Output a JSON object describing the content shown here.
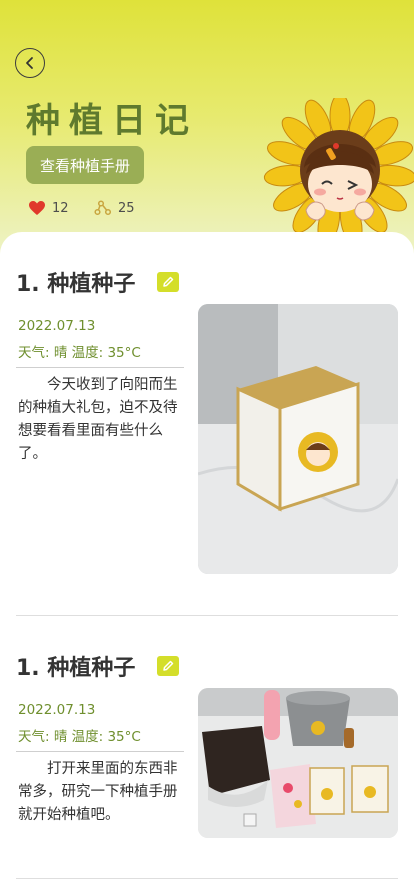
{
  "header": {
    "title": "种植日记",
    "manual_button": "查看种植手册",
    "likes": "12",
    "shares": "25"
  },
  "entries": [
    {
      "title": "1. 种植种子",
      "date": "2022.07.13",
      "weather": "天气: 晴  温度: 35°C",
      "text": "今天收到了向阳而生的种植大礼包，迫不及待想要看看里面有些什么了。"
    },
    {
      "title": "1. 种植种子",
      "date": "2022.07.13",
      "weather": "天气: 晴  温度: 35°C",
      "text": "打开来里面的东西非常多，研究一下种植手册就开始种植吧。"
    }
  ],
  "colors": {
    "accent_green": "#6f8f2e",
    "title_green": "#5f7a2e",
    "button_green": "#9aae55",
    "edit_yellow": "#d4de2a",
    "heart_red": "#e0392b"
  },
  "icons": [
    "back-arrow-icon",
    "heart-icon",
    "share-icon",
    "edit-pencil-icon"
  ]
}
